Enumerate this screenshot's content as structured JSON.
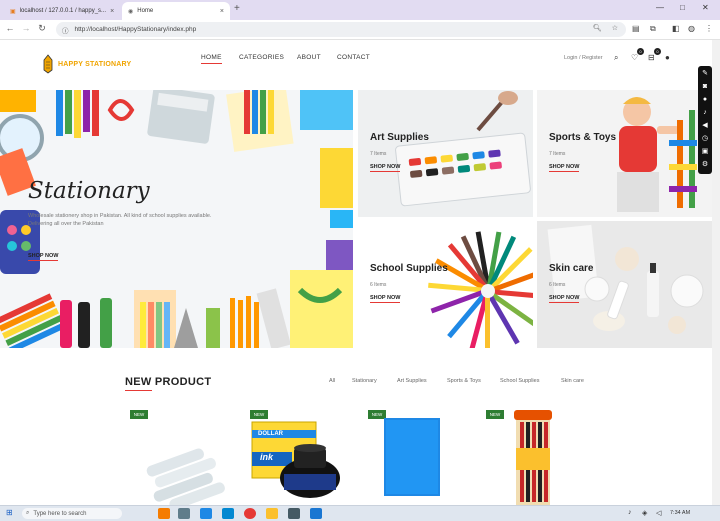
{
  "browser": {
    "tabs": [
      {
        "label": "localhost / 127.0.0.1 / happy_s...",
        "close": "×"
      },
      {
        "label": "Home",
        "close": "×"
      }
    ],
    "new_tab": "+",
    "url": "http://localhost/HappyStationary/index.php",
    "window_controls": {
      "minimize": "—",
      "maximize": "□",
      "close": "✕"
    }
  },
  "header": {
    "logo_text_a": "HAPPY",
    "logo_text_b": "STATIONARY",
    "nav": [
      "HOME",
      "CATEGORIES",
      "ABOUT",
      "CONTACT"
    ],
    "login": "Login / Register",
    "wishlist_count": "0",
    "cart_count": "0"
  },
  "hero": {
    "title": "Stationary",
    "description": "Wholesale stationery shop in Pakistan. All kind of school supplies available. Delivering all over the Pakistan",
    "link": "SHOP NOW"
  },
  "categories": [
    {
      "title": "Art Supplies",
      "count": "7 Items",
      "link": "SHOP NOW"
    },
    {
      "title": "Sports & Toys",
      "count": "7 Items",
      "link": "SHOP NOW"
    },
    {
      "title": "School Supplies",
      "count": "6 Items",
      "link": "SHOP NOW"
    },
    {
      "title": "Skin care",
      "count": "6 Items",
      "link": "SHOP NOW"
    }
  ],
  "new_product": {
    "title": "NEW PRODUCT",
    "filters": [
      "All",
      "Stationary",
      "Art Supplies",
      "Sports & Toys",
      "School Supplies",
      "Skin care"
    ],
    "badge": "NEW",
    "ink_brand": "DOLLAR",
    "ink_label": "ink"
  },
  "taskbar": {
    "search_placeholder": "Type here to search",
    "time": "7:34 AM"
  },
  "colors": {
    "accent": "#e53935",
    "brand": "#f0a400",
    "badge": "#2e7d32"
  }
}
